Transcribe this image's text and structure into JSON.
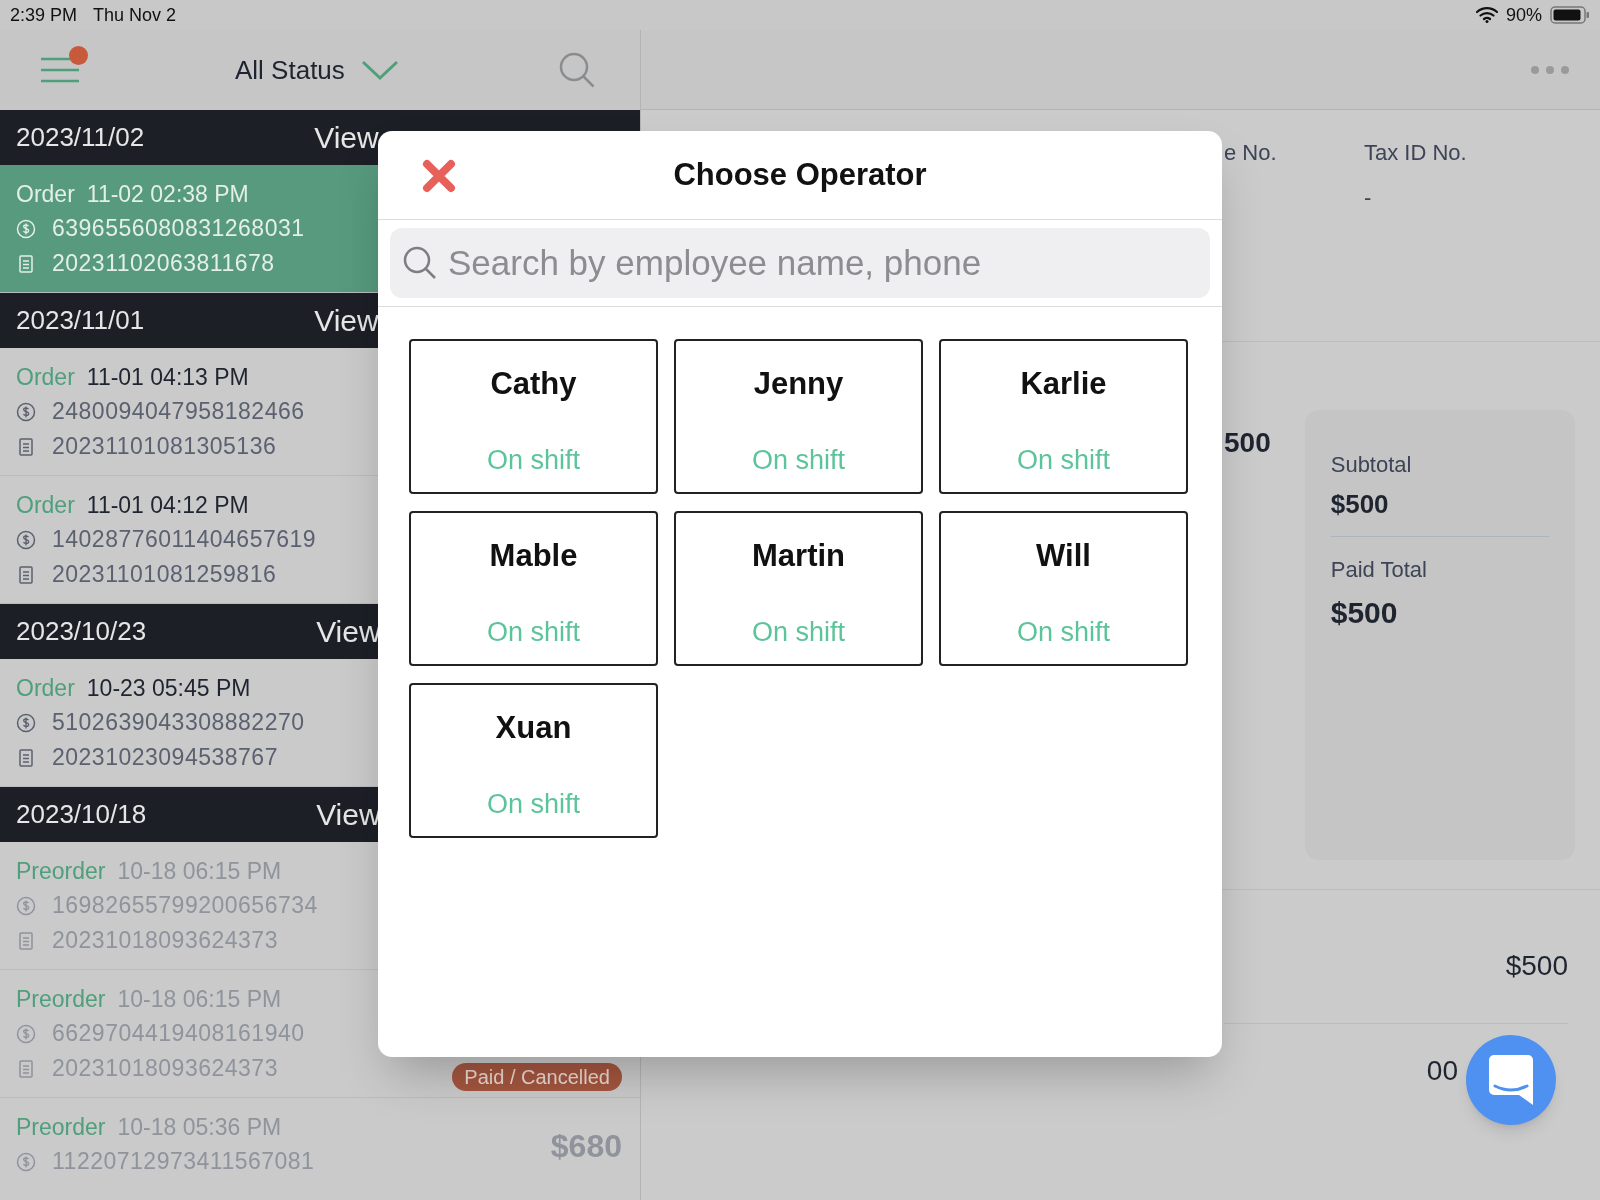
{
  "status_bar": {
    "time": "2:39 PM",
    "date": "Thu Nov 2",
    "battery": "90%"
  },
  "toolbar": {
    "notification_dot": true,
    "filter": "All Status"
  },
  "order_groups": [
    {
      "date": "2023/11/02",
      "action": "View",
      "orders": [
        {
          "type": "Order",
          "time": "11-02 02:38 PM",
          "payment_no": "6396556080831268031",
          "order_no": "20231102063811678",
          "selected": true,
          "dimmed": false
        }
      ]
    },
    {
      "date": "2023/11/01",
      "action": "View",
      "orders": [
        {
          "type": "Order",
          "time": "11-01 04:13 PM",
          "payment_no": "2480094047958182466",
          "order_no": "20231101081305136",
          "selected": false,
          "dimmed": false
        },
        {
          "type": "Order",
          "time": "11-01 04:12 PM",
          "payment_no": "14028776011404657619",
          "order_no": "20231101081259816",
          "selected": false,
          "dimmed": false
        }
      ]
    },
    {
      "date": "2023/10/23",
      "action": "View",
      "orders": [
        {
          "type": "Order",
          "time": "10-23 05:45 PM",
          "payment_no": "5102639043308882270",
          "order_no": "20231023094538767",
          "selected": false,
          "dimmed": false
        }
      ]
    },
    {
      "date": "2023/10/18",
      "action": "View",
      "orders": [
        {
          "type": "Preorder",
          "time": "10-18 06:15 PM",
          "payment_no": "16982655799200656734",
          "order_no": "20231018093624373",
          "selected": false,
          "dimmed": true
        },
        {
          "type": "Preorder",
          "time": "10-18 06:15 PM",
          "payment_no": "6629704419408161940",
          "order_no": "20231018093624373",
          "badge": "Paid / Cancelled",
          "selected": false,
          "dimmed": true
        },
        {
          "type": "Preorder",
          "time": "10-18 05:36 PM",
          "payment_no": "11220712973411567081",
          "amount": "$680",
          "selected": false,
          "dimmed": true
        }
      ]
    }
  ],
  "detail": {
    "columns": [
      {
        "label": "e No."
      },
      {
        "label": "Tax ID No.",
        "value": "-"
      }
    ],
    "partial_amount": "500",
    "summary": [
      {
        "label": "Subtotal",
        "value": "$500"
      },
      {
        "label": "Paid Total",
        "value": "$500"
      }
    ],
    "rows": [
      "$500",
      "00"
    ]
  },
  "modal": {
    "title": "Choose Operator",
    "search_placeholder": "Search by employee name, phone",
    "operators": [
      {
        "name": "Cathy",
        "status": "On shift"
      },
      {
        "name": "Jenny",
        "status": "On shift"
      },
      {
        "name": "Karlie",
        "status": "On shift"
      },
      {
        "name": "Mable",
        "status": "On shift"
      },
      {
        "name": "Martin",
        "status": "On shift"
      },
      {
        "name": "Will",
        "status": "On shift"
      },
      {
        "name": "Xuan",
        "status": "On shift"
      }
    ]
  }
}
